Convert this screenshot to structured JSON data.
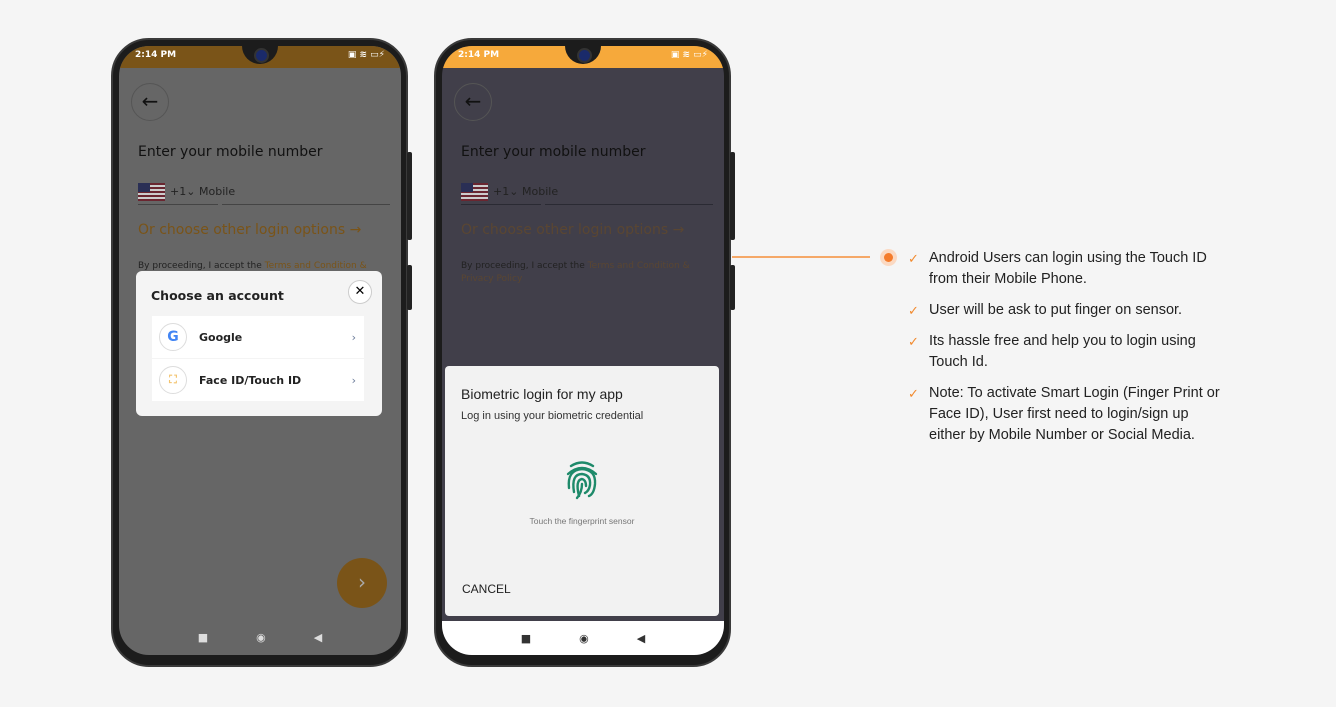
{
  "status": {
    "time": "2:14 PM",
    "battery": "85"
  },
  "login": {
    "title": "Enter your mobile number",
    "country_code": "+1",
    "mobile_placeholder": "Mobile",
    "other_options": "Or choose other login options",
    "terms_prefix": "By proceeding, I accept the ",
    "terms_link": "Terms and Condition & Privacy Policy"
  },
  "account_modal": {
    "title": "Choose an account",
    "options": [
      {
        "label": "Google",
        "icon": "google-icon"
      },
      {
        "label": "Face ID/Touch ID",
        "icon": "face-id-icon"
      }
    ]
  },
  "biometric": {
    "title": "Biometric login for my app",
    "subtitle": "Log in using your biometric credential",
    "hint": "Touch the fingerprint sensor",
    "cancel": "CANCEL"
  },
  "bullets": [
    "Android Users can login using the Touch ID from their Mobile Phone.",
    "User will be ask to put finger on sensor.",
    "Its hassle free and help you to login using Touch Id.",
    "Note: To activate Smart Login (Finger Print or Face ID), User first need to login/sign up either by Mobile Number or Social Media."
  ],
  "colors": {
    "accent": "#f28a2e",
    "status_left": "#7a5418",
    "status_right": "#f6a93b",
    "fingerprint": "#1e8a6a"
  }
}
